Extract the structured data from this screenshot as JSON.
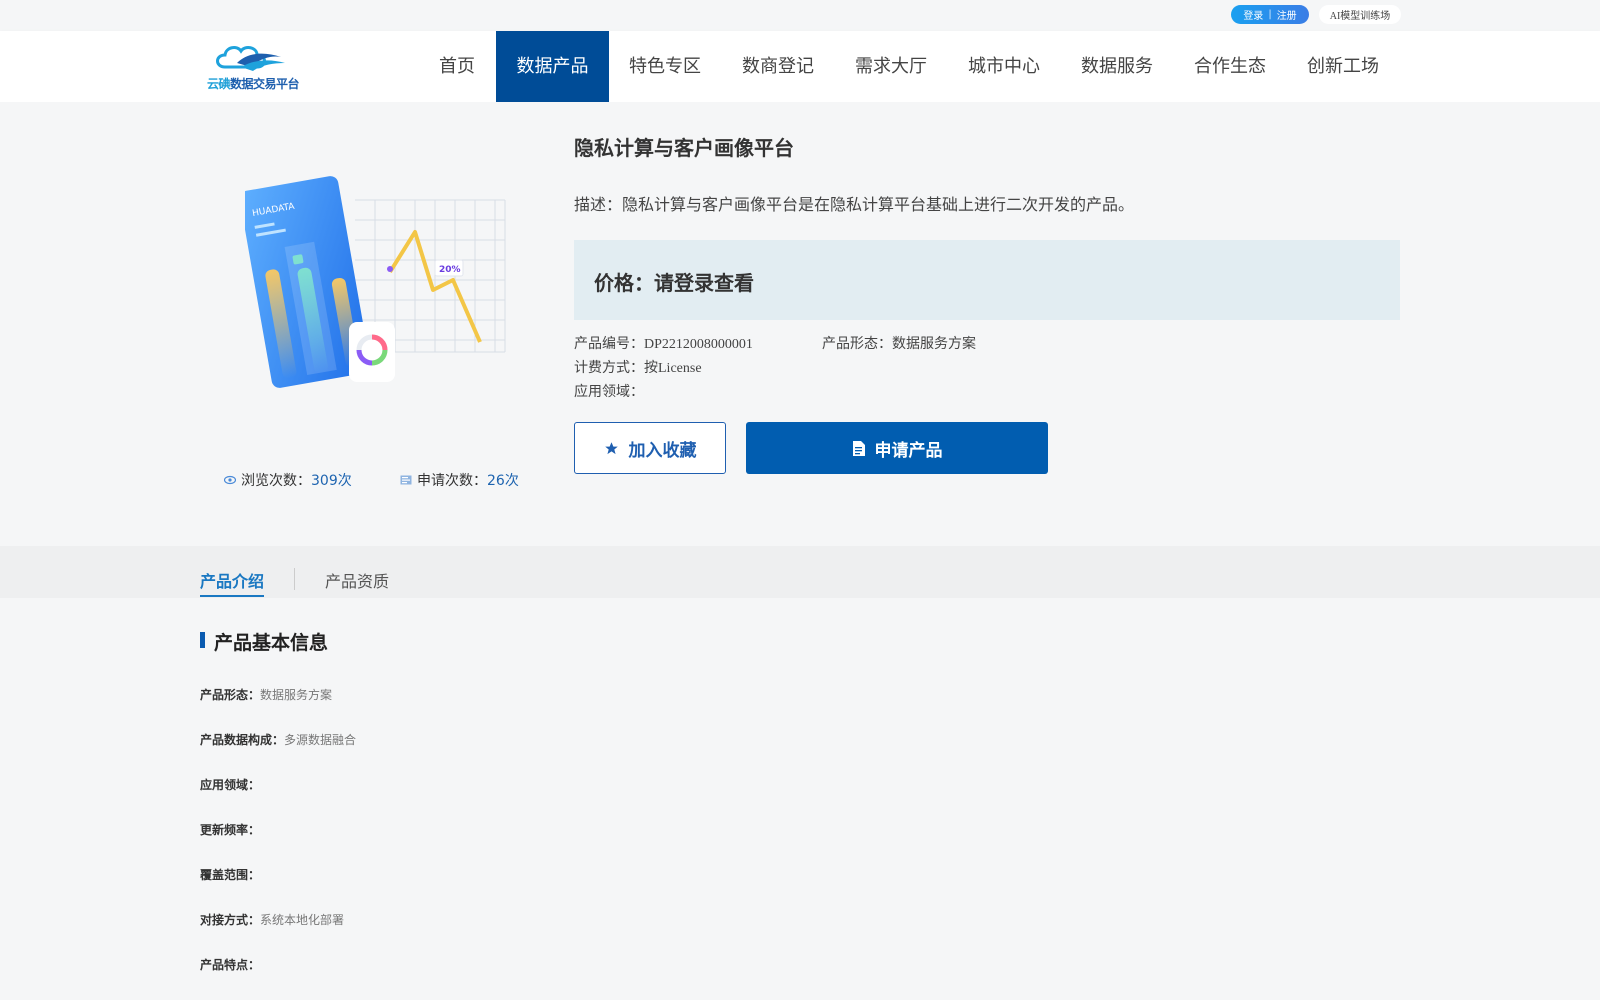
{
  "topbar": {
    "login": "登录",
    "separator": "|",
    "register": "注册",
    "ai_link": "AI模型训练场"
  },
  "logo": {
    "text_a": "云碘",
    "text_b": "数据交易平台"
  },
  "nav": {
    "items": [
      {
        "label": "首页"
      },
      {
        "label": "数据产品"
      },
      {
        "label": "特色专区"
      },
      {
        "label": "数商登记"
      },
      {
        "label": "需求大厅"
      },
      {
        "label": "城市中心"
      },
      {
        "label": "数据服务"
      },
      {
        "label": "合作生态"
      },
      {
        "label": "创新工场"
      }
    ],
    "active_index": 1
  },
  "illustration": {
    "brand": "HUADATA",
    "percent": "20%"
  },
  "stats": {
    "views_label": "浏览次数：",
    "views_value": "309次",
    "apply_label": "申请次数：",
    "apply_value": "26次"
  },
  "product": {
    "title": "隐私计算与客户画像平台",
    "description": "描述：隐私计算与客户画像平台是在隐私计算平台基础上进行二次开发的产品。",
    "price": "价格：请登录查看",
    "code": "产品编号：DP2212008000001",
    "form": "产品形态：数据服务方案",
    "billing": "计费方式：按License",
    "domain": "应用领域："
  },
  "buttons": {
    "favorite": "加入收藏",
    "apply": "申请产品"
  },
  "tabs": {
    "intro": "产品介绍",
    "qualification": "产品资质"
  },
  "basic_info": {
    "title": "产品基本信息",
    "rows": [
      {
        "key": "产品形态：",
        "value": "数据服务方案"
      },
      {
        "key": "产品数据构成：",
        "value": "多源数据融合"
      },
      {
        "key": "应用领域：",
        "value": ""
      },
      {
        "key": "更新频率：",
        "value": ""
      },
      {
        "key": "覆盖范围：",
        "value": ""
      },
      {
        "key": "对接方式：",
        "value": "系统本地化部署"
      },
      {
        "key": "产品特点：",
        "value": ""
      }
    ]
  },
  "colors": {
    "brand_dark": "#004c97",
    "button_blue": "#015db0",
    "accent_link": "#1a78c2",
    "price_bg": "#e2edf2"
  }
}
